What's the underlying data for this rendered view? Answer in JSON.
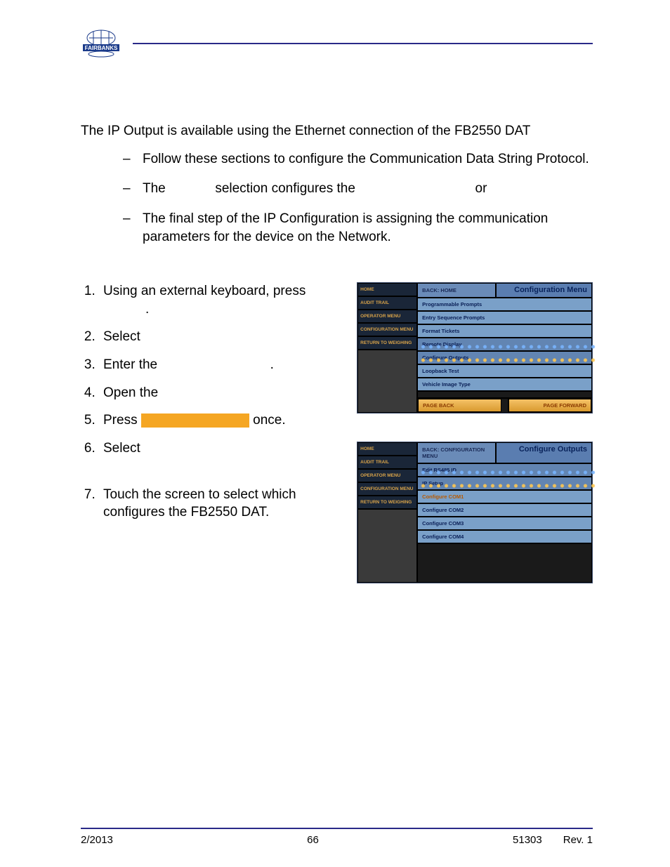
{
  "logo_text": "FAIRBANKS",
  "intro": "The IP Output is available using the Ethernet connection of the FB2550 DAT",
  "bullets": {
    "b1": "Follow these sections to configure the Communication Data String Protocol.",
    "b2a": "The",
    "b2b": "selection configures the",
    "b2c": "or",
    "b3": "The final step of the IP Configuration is assigning the communication parameters for the device on the Network."
  },
  "steps": {
    "s1": "Using an external keyboard, press",
    "s1b": ".",
    "s2": "Select",
    "s3a": "Enter the",
    "s3b": ".",
    "s4": "Open the",
    "s5a": "Press",
    "s5b": "once.",
    "s6": "Select",
    "s7": "Touch the screen to select which configures the FB2550 DAT."
  },
  "panel1": {
    "side": [
      "HOME",
      "AUDIT TRAIL",
      "OPERATOR MENU",
      "CONFIGURATION MENU",
      "RETURN TO WEIGHING"
    ],
    "back": "BACK: HOME",
    "title": "Configuration Menu",
    "rows": [
      "Programmable Prompts",
      "Entry Sequence Prompts",
      "Format Tickets",
      "Remote Display",
      "Configure Outputs",
      "Loopback Test",
      "Vehicle Image Type"
    ],
    "nav_back": "PAGE BACK",
    "nav_fwd": "PAGE FORWARD"
  },
  "panel2": {
    "side": [
      "HOME",
      "AUDIT TRAIL",
      "OPERATOR MENU",
      "CONFIGURATION MENU",
      "RETURN TO WEIGHING"
    ],
    "back": "BACK: CONFIGURATION MENU",
    "title": "Configure Outputs",
    "rows": [
      "Edit RS485 ID",
      "IP Setup",
      "Configure COM1",
      "Configure COM2",
      "Configure COM3",
      "Configure COM4"
    ]
  },
  "footer": {
    "left": "2/2013",
    "center": "66",
    "doc": "51303",
    "rev": "Rev. 1"
  }
}
